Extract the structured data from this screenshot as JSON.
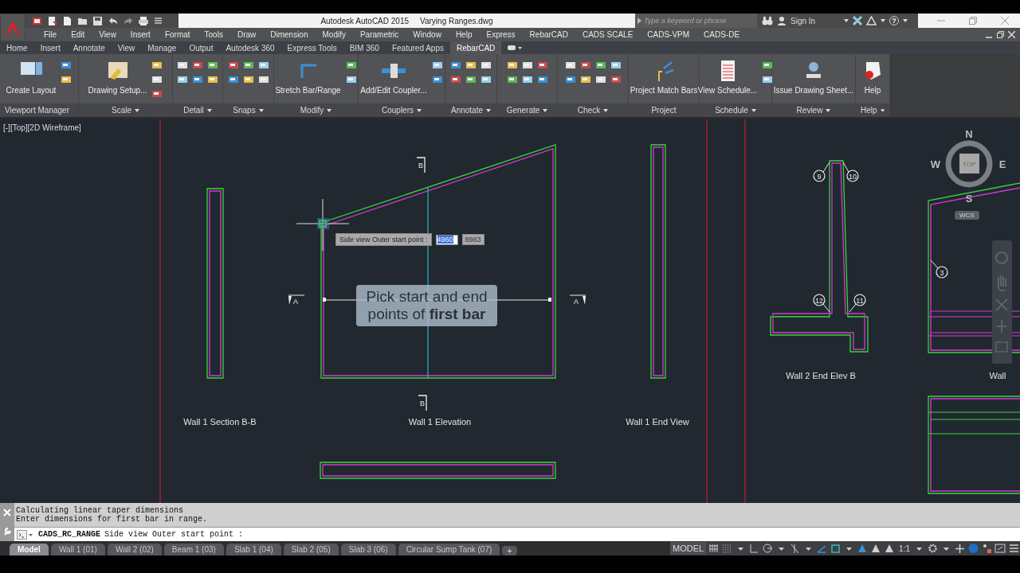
{
  "title_bar": {
    "app": "Autodesk AutoCAD 2015",
    "file": "Varying Ranges.dwg",
    "search": {
      "placeholder": "Type a keyword or phrase"
    },
    "sign_in": "Sign In",
    "help": "?"
  },
  "menu": [
    "File",
    "Edit",
    "View",
    "Insert",
    "Format",
    "Tools",
    "Draw",
    "Dimension",
    "Modify",
    "Parametric",
    "Window",
    "Help",
    "Express",
    "RebarCAD",
    "CADS SCALE",
    "CADS-VPM",
    "CADS-DE"
  ],
  "ribbon_tabs": [
    {
      "label": "Home",
      "selected": false
    },
    {
      "label": "Insert",
      "selected": false
    },
    {
      "label": "Annotate",
      "selected": false
    },
    {
      "label": "View",
      "selected": false
    },
    {
      "label": "Manage",
      "selected": false
    },
    {
      "label": "Output",
      "selected": false
    },
    {
      "label": "Autodesk 360",
      "selected": false
    },
    {
      "label": "Express Tools",
      "selected": false
    },
    {
      "label": "BIM 360",
      "selected": false
    },
    {
      "label": "Featured Apps",
      "selected": false
    },
    {
      "label": "RebarCAD",
      "selected": true
    }
  ],
  "ribbon_panels": [
    {
      "title": "Viewport Manager",
      "dropdown": true,
      "buttons": [
        "Create Layout"
      ]
    },
    {
      "title": "Scale",
      "dropdown": true,
      "buttons": [
        "Drawing Setup..."
      ]
    },
    {
      "title": "Detail",
      "dropdown": true
    },
    {
      "title": "Snaps",
      "dropdown": true
    },
    {
      "title": "Modify",
      "dropdown": true,
      "buttons": [
        "Stretch Bar/Range"
      ]
    },
    {
      "title": "Couplers",
      "dropdown": true,
      "buttons": [
        "Add/Edit Coupler..."
      ]
    },
    {
      "title": "Annotate",
      "dropdown": true
    },
    {
      "title": "Generate",
      "dropdown": true
    },
    {
      "title": "Check",
      "dropdown": true
    },
    {
      "title": "Project",
      "dropdown": false,
      "buttons": [
        "Project Match Bars"
      ]
    },
    {
      "title": "Schedule",
      "dropdown": true,
      "buttons": [
        "View Schedule..."
      ]
    },
    {
      "title": "Review",
      "dropdown": true,
      "buttons": [
        "Issue Drawing Sheet..."
      ]
    },
    {
      "title": "Help",
      "dropdown": true,
      "buttons": [
        "Help"
      ]
    }
  ],
  "viewport_label": "[-][Top][2D Wireframe]",
  "drawing": {
    "labels": [
      "Wall 1 Section B-B",
      "Wall 1 Elevation",
      "Wall 1 End View",
      "Wall 2 End Elev B",
      "Wall"
    ],
    "section_marks": [
      "B",
      "B",
      "A",
      "A"
    ],
    "callouts": [
      "9",
      "10",
      "12",
      "11",
      "3"
    ],
    "tooltip": {
      "prompt": "Side view Outer start point :",
      "x_value": "4960",
      "y_value": "8983"
    },
    "hint": "Pick start and end points of **first bar**"
  },
  "viewcube": {
    "north": "N",
    "west": "W",
    "east": "E",
    "south": "S",
    "face": "TOP",
    "ucs": "WCS"
  },
  "command_history": [
    "Calculating linear taper dimensions",
    "Enter dimensions for first bar in range."
  ],
  "command_line": {
    "command": "CADS_RC_RANGE",
    "prompt": "Side view Outer start point :"
  },
  "layout_tabs": [
    {
      "label": "Model",
      "selected": true
    },
    {
      "label": "Wall 1 (01)",
      "selected": false
    },
    {
      "label": "Wall 2 (02)",
      "selected": false
    },
    {
      "label": "Beam 1 (03)",
      "selected": false
    },
    {
      "label": "Slab 1 (04)",
      "selected": false
    },
    {
      "label": "Slab 2 (05)",
      "selected": false
    },
    {
      "label": "Slab 3 (06)",
      "selected": false
    },
    {
      "label": "Circular Sump Tank (07)",
      "selected": false
    }
  ],
  "add_tab": "+",
  "status_bar": {
    "space": "MODEL",
    "scale": "1:1"
  }
}
